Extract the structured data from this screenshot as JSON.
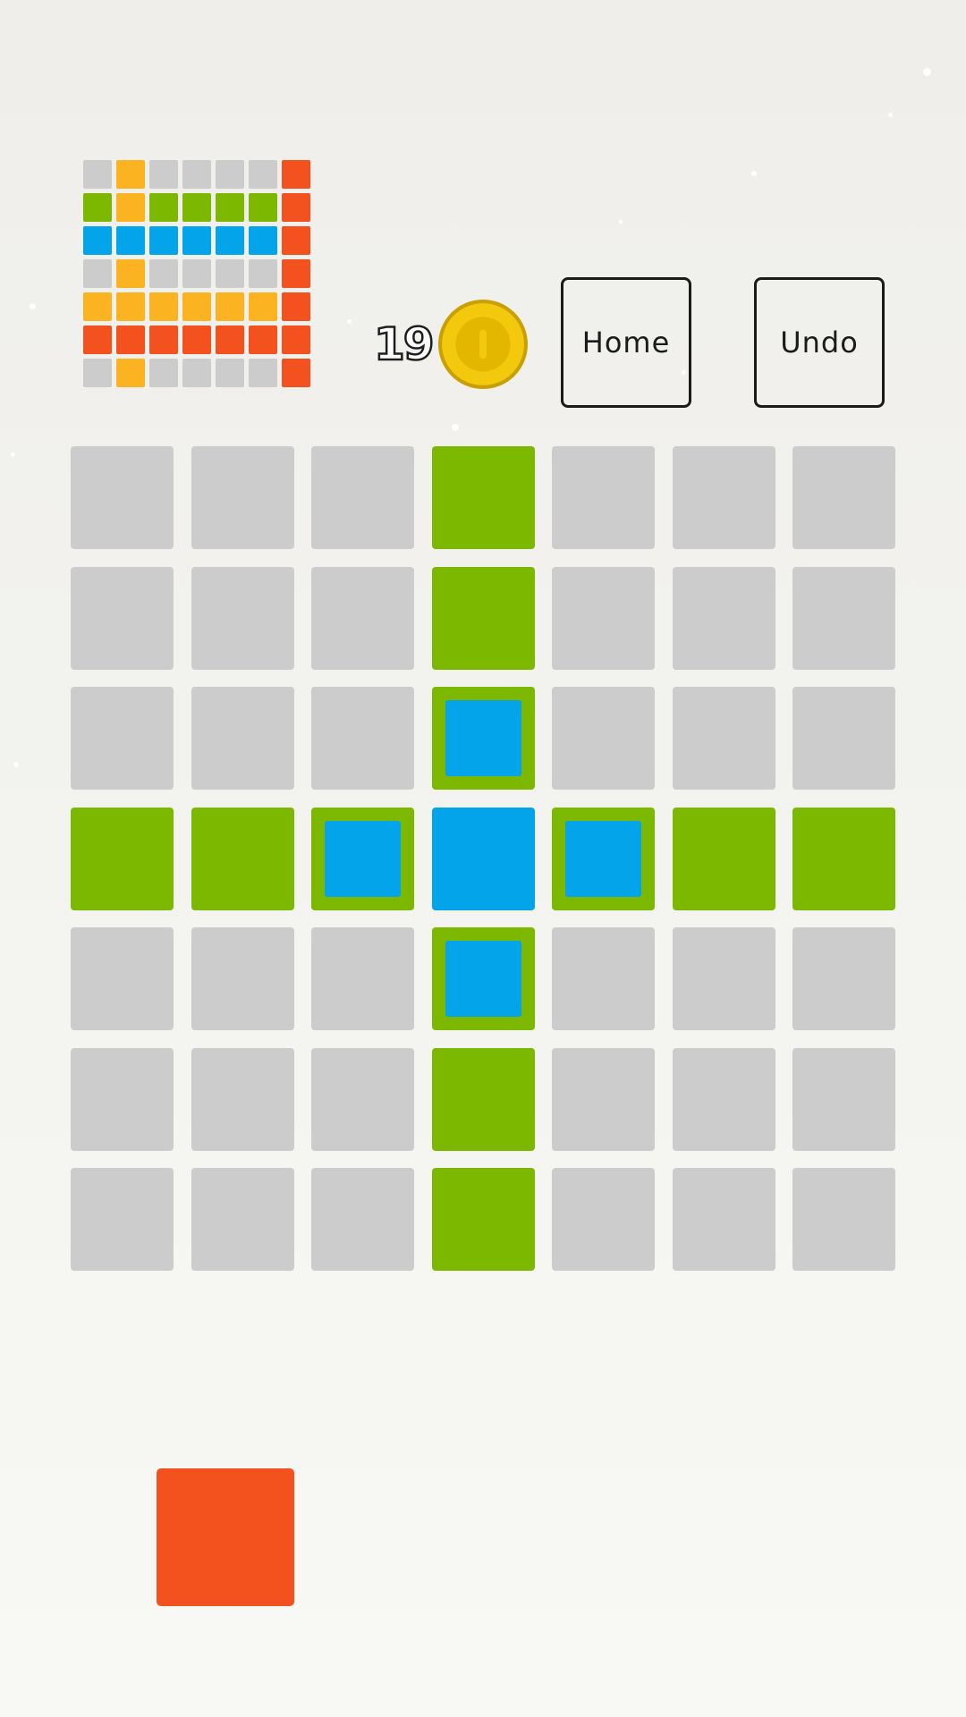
{
  "colors": {
    "gray": "#cccccc",
    "orange": "#fbb321",
    "green": "#7cb800",
    "blue": "#03a4e9",
    "red": "#f3511e",
    "coin_outer": "#f2c90c",
    "coin_inner": "#e3b700",
    "coin_stroke": "#c9a000"
  },
  "target_pattern": [
    [
      "gray",
      "orange",
      "gray",
      "gray",
      "gray",
      "gray",
      "red"
    ],
    [
      "green",
      "orange",
      "green",
      "green",
      "green",
      "green",
      "red"
    ],
    [
      "blue",
      "blue",
      "blue",
      "blue",
      "blue",
      "blue",
      "red"
    ],
    [
      "gray",
      "orange",
      "gray",
      "gray",
      "gray",
      "gray",
      "red"
    ],
    [
      "orange",
      "orange",
      "orange",
      "orange",
      "orange",
      "orange",
      "red"
    ],
    [
      "red",
      "red",
      "red",
      "red",
      "red",
      "red",
      "red"
    ],
    [
      "gray",
      "orange",
      "gray",
      "gray",
      "gray",
      "gray",
      "red"
    ]
  ],
  "coins": {
    "count": "19",
    "icon": "coin-icon"
  },
  "buttons": {
    "home_label": "Home",
    "undo_label": "Undo"
  },
  "board": [
    [
      [
        "gray"
      ],
      [
        "gray"
      ],
      [
        "gray"
      ],
      [
        "green"
      ],
      [
        "gray"
      ],
      [
        "gray"
      ],
      [
        "gray"
      ]
    ],
    [
      [
        "gray"
      ],
      [
        "gray"
      ],
      [
        "gray"
      ],
      [
        "green"
      ],
      [
        "gray"
      ],
      [
        "gray"
      ],
      [
        "gray"
      ]
    ],
    [
      [
        "gray"
      ],
      [
        "gray"
      ],
      [
        "gray"
      ],
      [
        "green",
        "blue"
      ],
      [
        "gray"
      ],
      [
        "gray"
      ],
      [
        "gray"
      ]
    ],
    [
      [
        "green"
      ],
      [
        "green"
      ],
      [
        "green",
        "blue"
      ],
      [
        "blue"
      ],
      [
        "green",
        "blue"
      ],
      [
        "green"
      ],
      [
        "green"
      ]
    ],
    [
      [
        "gray"
      ],
      [
        "gray"
      ],
      [
        "gray"
      ],
      [
        "green",
        "blue"
      ],
      [
        "gray"
      ],
      [
        "gray"
      ],
      [
        "gray"
      ]
    ],
    [
      [
        "gray"
      ],
      [
        "gray"
      ],
      [
        "gray"
      ],
      [
        "green"
      ],
      [
        "gray"
      ],
      [
        "gray"
      ],
      [
        "gray"
      ]
    ],
    [
      [
        "gray"
      ],
      [
        "gray"
      ],
      [
        "gray"
      ],
      [
        "green"
      ],
      [
        "gray"
      ],
      [
        "gray"
      ],
      [
        "gray"
      ]
    ]
  ],
  "active_piece": {
    "color": "red"
  }
}
